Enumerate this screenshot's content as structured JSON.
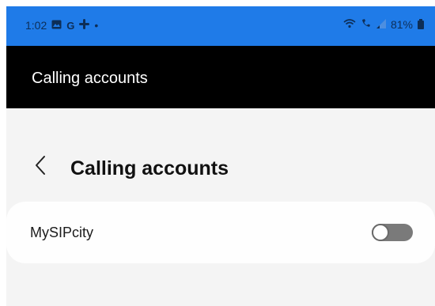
{
  "status_bar": {
    "time": "1:02",
    "notification_icons": [
      "photo-icon",
      "google-icon",
      "slack-icon"
    ],
    "dot": "•",
    "battery_percent": "81%",
    "system_icons": [
      "wifi-call-icon",
      "vowifi-icon",
      "signal-icon",
      "battery-icon"
    ]
  },
  "title_bar": {
    "title": "Calling accounts"
  },
  "header": {
    "back_icon": "chevron-left-icon",
    "title": "Calling accounts"
  },
  "accounts": [
    {
      "label": "MySIPcity",
      "enabled": false
    }
  ],
  "colors": {
    "status_bar": "#1f7be8",
    "title_bar": "#000000",
    "background": "#f4f4f4",
    "toggle_off": "#7a7a7a"
  }
}
